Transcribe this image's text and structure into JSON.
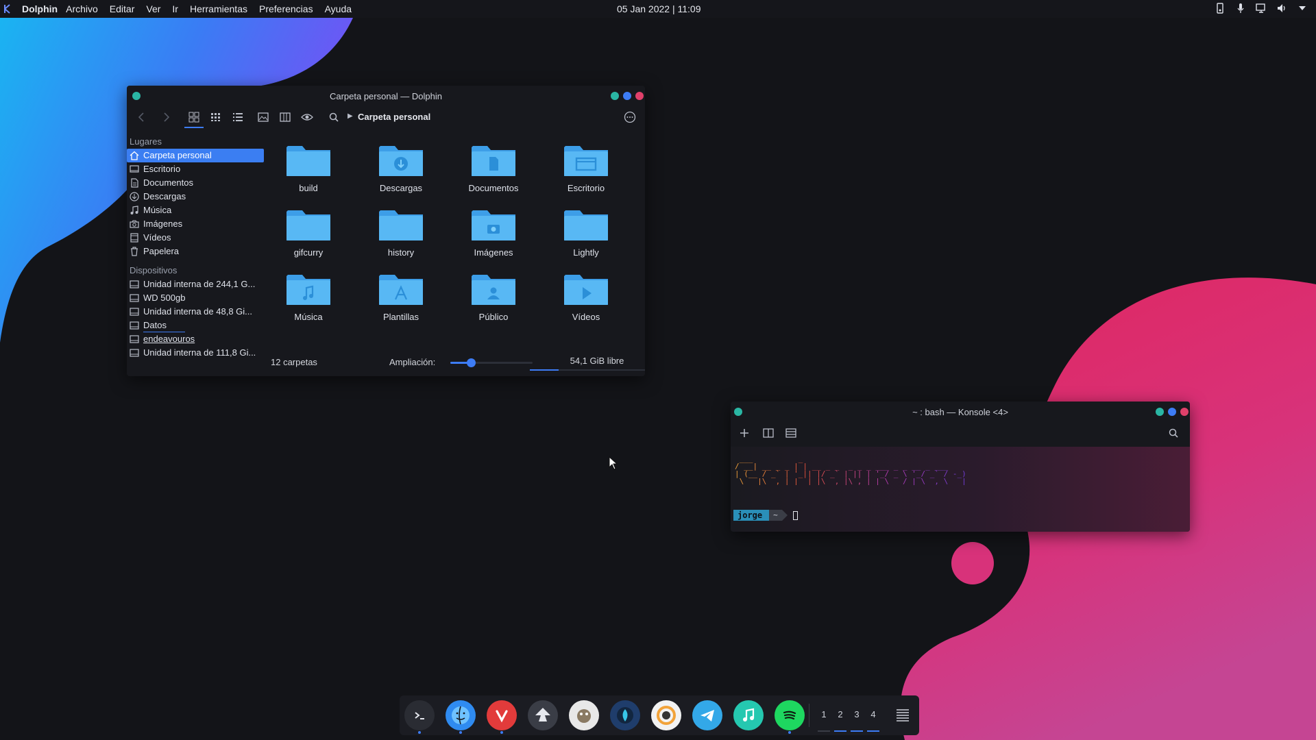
{
  "colors": {
    "accent": "#3b7ef2",
    "dot_green": "#2ab6a4",
    "dot_blue": "#3d7cf5",
    "dot_red": "#e0406a",
    "folder": "#58b8f4"
  },
  "topbar": {
    "app_name": "Dolphin",
    "menu": [
      "Archivo",
      "Editar",
      "Ver",
      "Ir",
      "Herramientas",
      "Preferencias",
      "Ayuda"
    ],
    "clock": "05 Jan 2022 | 11:09",
    "tray_icons": [
      "storage-icon",
      "microphone-icon",
      "network-icon",
      "volume-icon",
      "arrow-down-icon"
    ]
  },
  "dolphin": {
    "title": "Carpeta personal — Dolphin",
    "breadcrumb": "Carpeta personal",
    "places_title": "Lugares",
    "places": [
      {
        "label": "Carpeta personal",
        "icon": "home-icon"
      },
      {
        "label": "Escritorio",
        "icon": "desktop-icon"
      },
      {
        "label": "Documentos",
        "icon": "document-icon"
      },
      {
        "label": "Descargas",
        "icon": "download-icon"
      },
      {
        "label": "Música",
        "icon": "music-icon"
      },
      {
        "label": "Imágenes",
        "icon": "camera-icon"
      },
      {
        "label": "Vídeos",
        "icon": "video-icon"
      },
      {
        "label": "Papelera",
        "icon": "trash-icon"
      }
    ],
    "devices_title": "Dispositivos",
    "devices": [
      {
        "label": "Unidad interna de 244,1 G..."
      },
      {
        "label": "WD 500gb"
      },
      {
        "label": "Unidad interna de 48,8 Gi..."
      },
      {
        "label": "Datos",
        "usage": 0.55
      },
      {
        "label": "endeavouros"
      },
      {
        "label": "Unidad interna de 111,8 Gi..."
      }
    ],
    "folders": [
      {
        "label": "build",
        "emblem": "none"
      },
      {
        "label": "Descargas",
        "emblem": "download"
      },
      {
        "label": "Documentos",
        "emblem": "document"
      },
      {
        "label": "Escritorio",
        "emblem": "desktop"
      },
      {
        "label": "gifcurry",
        "emblem": "none"
      },
      {
        "label": "history",
        "emblem": "none"
      },
      {
        "label": "Imágenes",
        "emblem": "camera"
      },
      {
        "label": "Lightly",
        "emblem": "none"
      },
      {
        "label": "Música",
        "emblem": "music"
      },
      {
        "label": "Plantillas",
        "emblem": "templates"
      },
      {
        "label": "Público",
        "emblem": "public"
      },
      {
        "label": "Vídeos",
        "emblem": "video"
      }
    ],
    "status_count": "12 carpetas",
    "zoom_label": "Ampliación:",
    "zoom_level": 0.25,
    "free_space": "54,1 GiB libre",
    "used_fraction": 0.25
  },
  "konsole": {
    "title": "~ : bash — Konsole <4>",
    "ascii_art": " ___          _  \n/ __| __ _ _ | | __ _ _  _ _ _ ___ _ _ __ _ ___\n| (__ / _` | '_|| |/ _` | || | '_/ _ \\ '_/ _` / -_)\n \\___|\\__,_|_|  |_|\\__,_|\\_,_|_| \\___/_| \\__,_\\___|",
    "prompt_user": "jorge",
    "prompt_dir": "~"
  },
  "dock": {
    "apps": [
      {
        "name": "terminal",
        "running": true,
        "color": "#2a2c33"
      },
      {
        "name": "finder",
        "running": true,
        "color": "#2f8bf0"
      },
      {
        "name": "vivaldi",
        "running": true,
        "color": "#e23b3b"
      },
      {
        "name": "inkscape",
        "running": false,
        "color": "#3a3d46"
      },
      {
        "name": "gimp",
        "running": false,
        "color": "#e8e8e8"
      },
      {
        "name": "krita",
        "running": false,
        "color": "#1f3d6b"
      },
      {
        "name": "disk-usage",
        "running": false,
        "color": "#f2f2f2"
      },
      {
        "name": "telegram",
        "running": false,
        "color": "#33a8e8"
      },
      {
        "name": "music",
        "running": false,
        "color": "#25c8b0"
      },
      {
        "name": "spotify",
        "running": true,
        "color": "#1ed760"
      }
    ],
    "desktops": [
      "1",
      "2",
      "3",
      "4"
    ],
    "desktops_used": [
      false,
      true,
      true,
      true
    ]
  }
}
